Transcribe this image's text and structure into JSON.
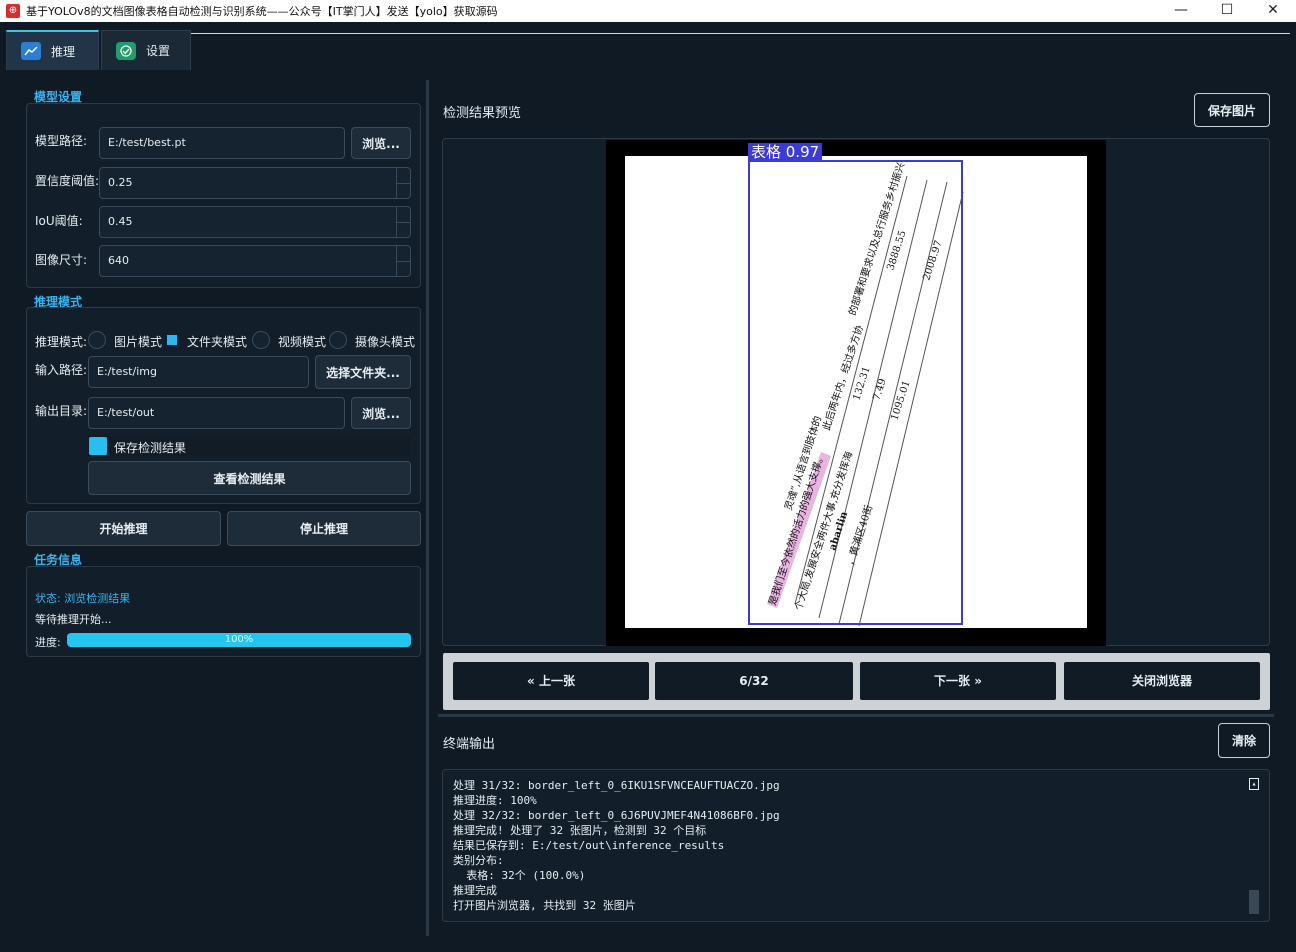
{
  "window": {
    "title": "基于YOLOv8的文档图像表格自动检测与识别系统——公众号【IT掌门人】发送【yolo】获取源码",
    "controls": [
      "—",
      "☐",
      "✕"
    ]
  },
  "tabs": [
    {
      "label": "推理",
      "icon": "chart-icon"
    },
    {
      "label": "设置",
      "icon": "check-icon"
    }
  ],
  "model_settings": {
    "title": "模型设置",
    "model_path_label": "模型路径:",
    "model_path_value": "E:/test/best.pt",
    "browse_label": "浏览...",
    "conf_label": "置信度阈值:",
    "conf_value": "0.25",
    "iou_label": "IoU阈值:",
    "iou_value": "0.45",
    "imgsz_label": "图像尺寸:",
    "imgsz_value": "640"
  },
  "inference_mode": {
    "title": "推理模式",
    "mode_label": "推理模式:",
    "options": [
      "图片模式",
      "文件夹模式",
      "视频模式",
      "摄像头模式"
    ],
    "selected": "文件夹模式",
    "input_label": "输入路径:",
    "input_value": "E:/test/img",
    "select_folder_label": "选择文件夹...",
    "output_label": "输出目录:",
    "output_value": "E:/test/out",
    "browse_label": "浏览...",
    "save_results_label": "保存检测结果",
    "view_results_label": "查看检测结果"
  },
  "actions": {
    "start_label": "开始推理",
    "stop_label": "停止推理"
  },
  "task_info": {
    "title": "任务信息",
    "status": "状态: 浏览检测结果",
    "waiting": "等待推理开始...",
    "progress_label": "进度:",
    "progress_text": "100%",
    "progress_value": 1.0
  },
  "preview": {
    "title": "检测结果预览",
    "save_label": "保存图片",
    "detection_label": "表格 0.97",
    "doc_texts": {
      "col1": "灵魂”,从语言到肢体的",
      "col2": "是我们至今依然的活力的强大支撑。",
      "col3": "个大局,发展安全两件大事,充分发挥海",
      "col4": "abarlin",
      "col5": "，黄浦区40街",
      "col6": "此后两年内，经过多方协",
      "col7": "的部署和要求以及总行服务乡村振兴",
      "n1": "132.31",
      "n2": "7.49",
      "n3": "1095.01",
      "n4": "3888.55",
      "n5": "2008.97"
    }
  },
  "navigation": {
    "prev_label": "« 上一张",
    "counter": "6/32",
    "next_label": "下一张 »",
    "close_label": "关闭浏览器"
  },
  "terminal": {
    "title": "终端输出",
    "clear_label": "清除",
    "lines": [
      "处理 31/32: border_left_0_6IKU1SFVNCEAUFTUACZO.jpg",
      "推理进度: 100%",
      "处理 32/32: border_left_0_6J6PUVJMEF4N41086BF0.jpg",
      "推理完成! 处理了 32 张图片，检测到 32 个目标",
      "结果已保存到: E:/test/out\\inference_results",
      "类别分布:",
      "  表格: 32个 (100.0%)",
      "推理完成",
      "打开图片浏览器, 共找到 32 张图片"
    ]
  },
  "colors": {
    "accent": "#37c4f0",
    "background": "#0f1a24",
    "detection_box": "#3b3bd6"
  }
}
